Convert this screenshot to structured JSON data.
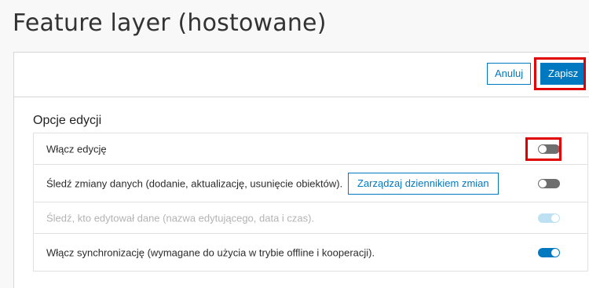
{
  "page": {
    "title": "Feature layer (hostowane)"
  },
  "toolbar": {
    "cancel_label": "Anuluj",
    "save_label": "Zapisz"
  },
  "editing": {
    "section_title": "Opcje edycji",
    "options": [
      {
        "label": "Włącz edycję",
        "enabled": false,
        "disabled": false,
        "highlighted": true
      },
      {
        "label": "Śledź zmiany danych (dodanie, aktualizację, usunięcie obiektów).",
        "enabled": false,
        "disabled": false,
        "button_label": "Zarządzaj dziennikiem zmian"
      },
      {
        "label": "Śledź, kto edytował dane (nazwa edytującego, data i czas).",
        "enabled": true,
        "disabled": true
      },
      {
        "label": "Włącz synchronizację (wymagane do użycia w trybie offline i kooperacji).",
        "enabled": true,
        "disabled": false
      }
    ]
  },
  "colors": {
    "accent": "#0079c1",
    "highlight": "#e00000",
    "toggle_off": "#6e6e6e",
    "toggle_disabled": "#bde0f2"
  }
}
